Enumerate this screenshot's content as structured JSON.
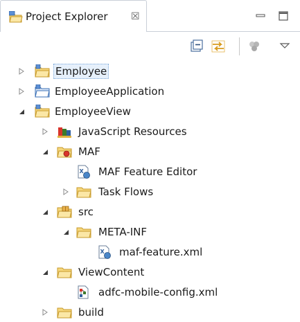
{
  "tab": {
    "title": "Project Explorer",
    "close_glyph": "☒"
  },
  "toolbar": {
    "icons": [
      "collapse-all-icon",
      "link-with-editor-icon",
      "filter-icon",
      "view-menu-icon"
    ]
  },
  "tree": [
    {
      "label": "Employee",
      "state": "collapsed",
      "icon": "project-folder-icon",
      "selected": true
    },
    {
      "label": "EmployeeApplication",
      "state": "collapsed",
      "icon": "application-folder-icon"
    },
    {
      "label": "EmployeeView",
      "state": "expanded",
      "icon": "project-folder-icon"
    },
    {
      "label": "JavaScript Resources",
      "state": "collapsed",
      "icon": "javascript-library-icon"
    },
    {
      "label": "MAF",
      "state": "expanded",
      "icon": "maf-folder-icon"
    },
    {
      "label": "MAF Feature Editor",
      "state": "leaf",
      "icon": "maf-feature-file-icon"
    },
    {
      "label": "Task Flows",
      "state": "collapsed",
      "icon": "folder-icon"
    },
    {
      "label": "src",
      "state": "expanded",
      "icon": "source-package-icon"
    },
    {
      "label": "META-INF",
      "state": "expanded",
      "icon": "folder-icon"
    },
    {
      "label": "maf-feature.xml",
      "state": "leaf",
      "icon": "xml-file-icon"
    },
    {
      "label": "ViewContent",
      "state": "expanded",
      "icon": "folder-icon"
    },
    {
      "label": "adfc-mobile-config.xml",
      "state": "leaf",
      "icon": "taskflow-config-icon"
    },
    {
      "label": "build",
      "state": "collapsed",
      "icon": "folder-icon"
    }
  ],
  "colors": {
    "selection_bg": "#e6f0fb",
    "folder_fill": "#f6d77c",
    "folder_stroke": "#c79a2b",
    "twisty": "#8a8a8a"
  }
}
